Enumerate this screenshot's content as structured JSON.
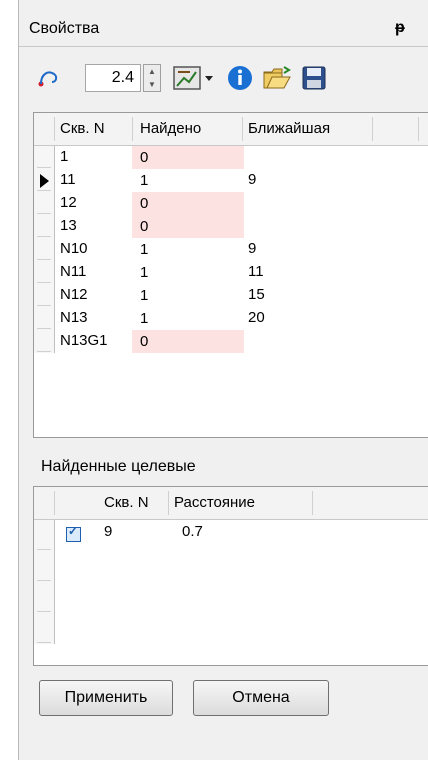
{
  "panel": {
    "title": "Свойства",
    "pin_glyph": "ᵽ"
  },
  "toolbar": {
    "spin_value": "2.4",
    "icons": [
      "radius-icon",
      "style-dropdown-icon",
      "info-icon",
      "open-folder-icon",
      "save-icon"
    ]
  },
  "grid1": {
    "columns": [
      "Скв. N",
      "Найдено",
      "Ближайшая"
    ],
    "rows": [
      {
        "skv": "1",
        "found": "0",
        "nearest": "",
        "pink": true
      },
      {
        "skv": "11",
        "found": "1",
        "nearest": "9",
        "pink": false,
        "current": true
      },
      {
        "skv": "12",
        "found": "0",
        "nearest": "",
        "pink": true
      },
      {
        "skv": "13",
        "found": "0",
        "nearest": "",
        "pink": true
      },
      {
        "skv": "N10",
        "found": "1",
        "nearest": "9",
        "pink": false
      },
      {
        "skv": "N11",
        "found": "1",
        "nearest": "11",
        "pink": false
      },
      {
        "skv": "N12",
        "found": "1",
        "nearest": "15",
        "pink": false
      },
      {
        "skv": "N13",
        "found": "1",
        "nearest": "20",
        "pink": false
      },
      {
        "skv": "N13G1",
        "found": "0",
        "nearest": "",
        "pink": true
      }
    ]
  },
  "targets": {
    "label": "Найденные целевые",
    "columns": [
      "Скв. N",
      "Расстояние"
    ],
    "rows": [
      {
        "checked": true,
        "skv": "9",
        "distance": "0.7"
      }
    ]
  },
  "buttons": {
    "apply": "Применить",
    "cancel": "Отмена"
  }
}
